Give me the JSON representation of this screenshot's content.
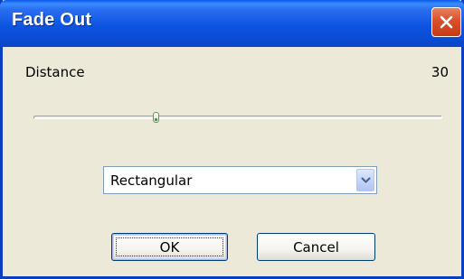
{
  "window": {
    "title": "Fade Out",
    "close_icon": "close-icon",
    "accent_color": "#0a4cd6",
    "close_color": "#d9502a"
  },
  "distance": {
    "label": "Distance",
    "value": "30",
    "slider_fraction": 0.3
  },
  "shape_select": {
    "selected": "Rectangular",
    "arrow_icon": "chevron-down-icon"
  },
  "buttons": {
    "ok": "OK",
    "cancel": "Cancel"
  }
}
